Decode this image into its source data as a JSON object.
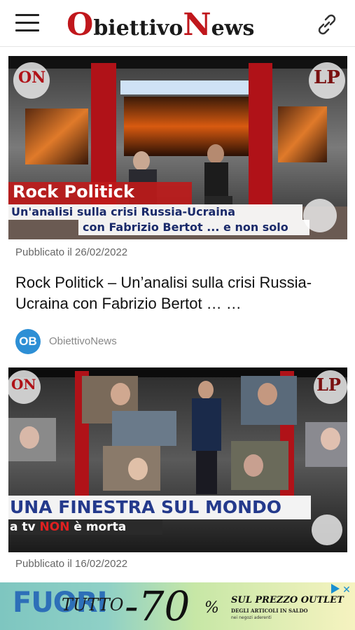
{
  "header": {
    "logo_part1_initial": "O",
    "logo_part1_rest": "biettivo",
    "logo_part2_initial": "N",
    "logo_part2_rest": "ews",
    "menu_icon": "hamburger-menu-icon",
    "link_icon": "chain-link-icon"
  },
  "posts": [
    {
      "thumb_title": "Rock Politick",
      "thumb_line1": "Un'analisi sulla crisi Russia-Ucraina",
      "thumb_line2": "con Fabrizio Bertot ... e non solo",
      "thumb_logo_left": "ON",
      "thumb_logo_right": "LP",
      "date": "Pubblicato il 26/02/2022",
      "title": "Rock Politick – Un’analisi sulla crisi Russia-Ucraina con Fabrizio Bertot … …",
      "author_initials": "OB",
      "author_name": "ObiettivoNews"
    },
    {
      "thumb_title": "UNA FINESTRA SUL MONDO",
      "thumb_line1_pre": "a tv ",
      "thumb_line1_hl": "NON",
      "thumb_line1_post": " è morta",
      "thumb_logo_left": "ON",
      "thumb_logo_right": "LP",
      "date": "Pubblicato il 16/02/2022"
    }
  ],
  "ad": {
    "brand": "FUORI",
    "word": "TUTTO",
    "discount": "-70",
    "percent": "%",
    "line1": "SUL PREZZO OUTLET",
    "line2": "DEGLI ARTICOLI IN SALDO",
    "line3": "nei negozi aderenti"
  },
  "colors": {
    "brand_red": "#c0171c",
    "avatar_blue": "#2d8fd5",
    "highlight_red": "#e02020",
    "banner_blue": "#243a8c"
  }
}
